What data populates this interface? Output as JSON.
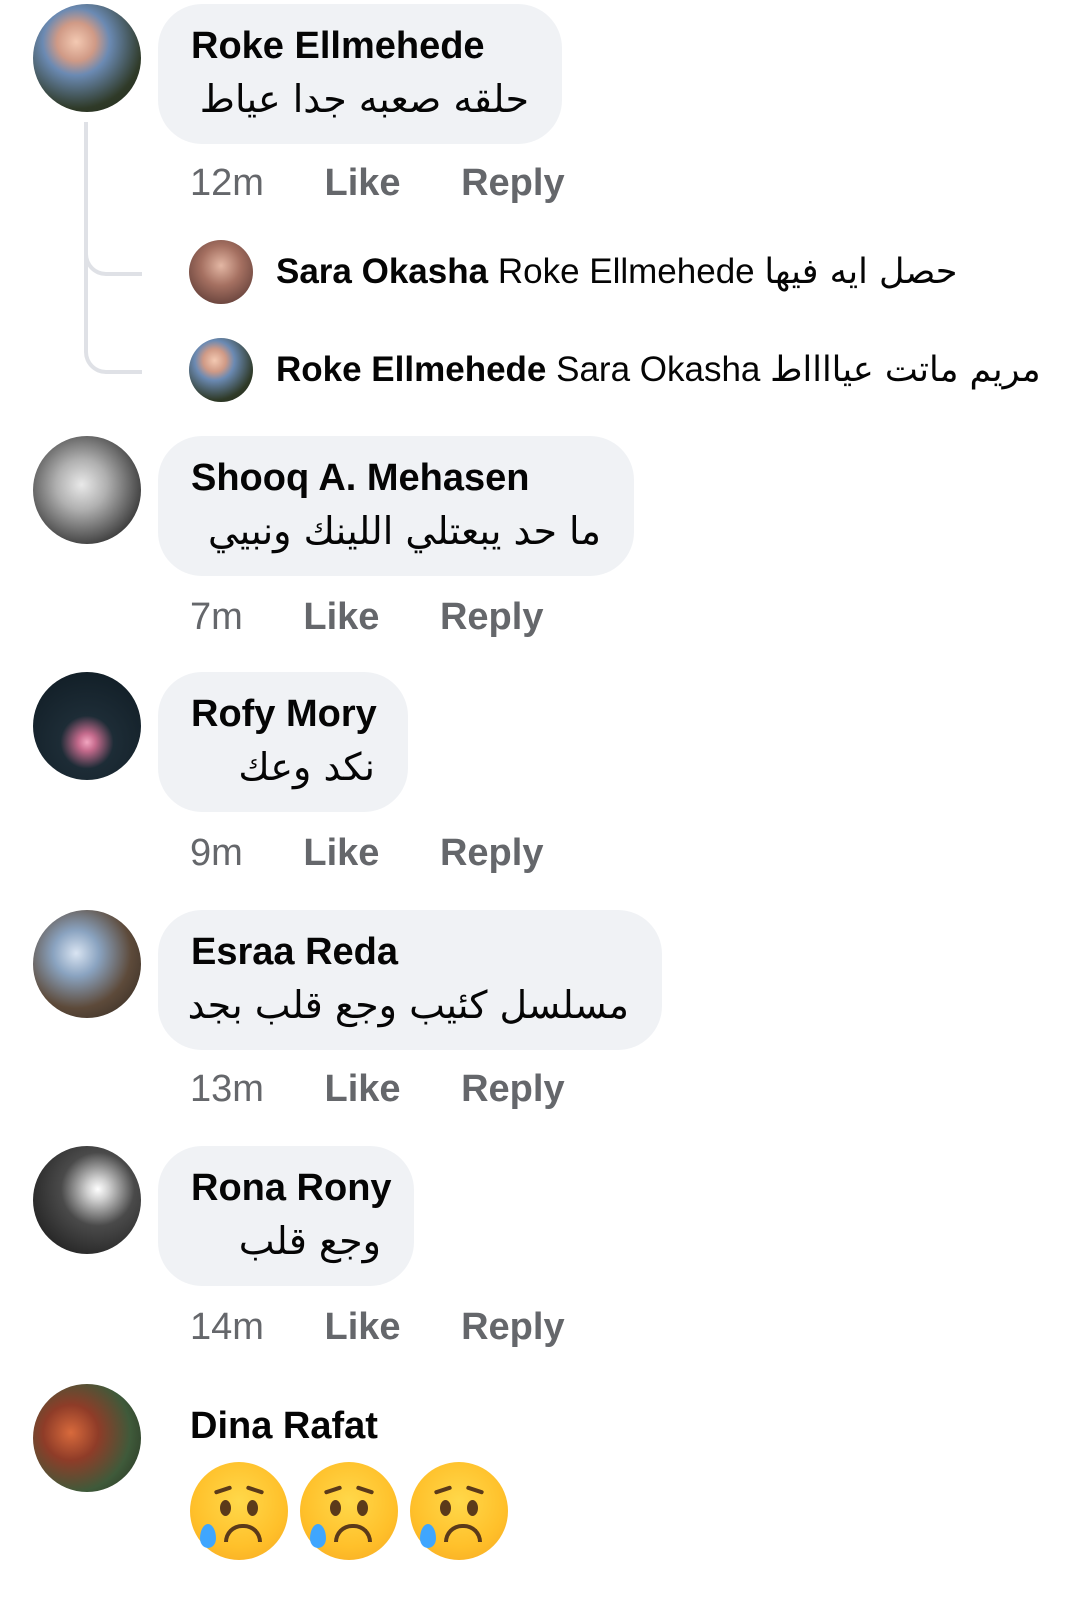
{
  "comments": [
    {
      "name": "Roke Ellmehede",
      "text": "حلقه صعبه جدا عياط",
      "time": "12m",
      "like": "Like",
      "reply": "Reply"
    },
    {
      "name": "Shooq A. Mehasen",
      "text": "ما حد يبعتلي اللينك ونبيي",
      "time": "7m",
      "like": "Like",
      "reply": "Reply"
    },
    {
      "name": "Rofy Mory",
      "text": "نكد وعك",
      "time": "9m",
      "like": "Like",
      "reply": "Reply"
    },
    {
      "name": "Esraa Reda",
      "text": "مسلسل كئيب وجع قلب بجد",
      "time": "13m",
      "like": "Like",
      "reply": "Reply"
    },
    {
      "name": "Rona Rony",
      "text": "وجع قلب",
      "time": "14m",
      "like": "Like",
      "reply": "Reply"
    },
    {
      "name": "Dina Rafat"
    }
  ],
  "replies": [
    {
      "name": "Sara Okasha",
      "tag": "Roke Ellmehede",
      "text": "حصل ايه فيها"
    },
    {
      "name": "Roke Ellmehede",
      "tag": "Sara Okasha",
      "text": "مريم ماتت عيااااط"
    }
  ],
  "icons": {
    "emoji": "crying-face-icon"
  }
}
